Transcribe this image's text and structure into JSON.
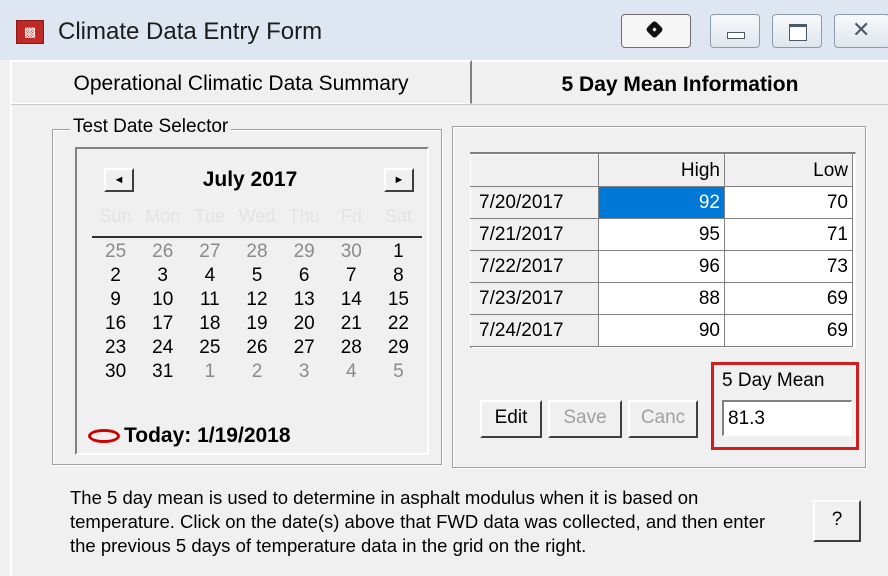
{
  "window": {
    "title": "Climate Data Entry Form"
  },
  "tabs": [
    {
      "label": "Operational Climatic Data Summary",
      "selected": false
    },
    {
      "label": "5 Day Mean Information",
      "selected": true
    }
  ],
  "date_selector": {
    "group_label": "Test Date Selector",
    "prev_arrow": "◄",
    "next_arrow": "►",
    "month_label": "July 2017",
    "weekdays": [
      "Sun",
      "Mon",
      "Tue",
      "Wed",
      "Thu",
      "Fri",
      "Sat"
    ],
    "weeks": [
      [
        "25",
        "26",
        "27",
        "28",
        "29",
        "30",
        "1"
      ],
      [
        "2",
        "3",
        "4",
        "5",
        "6",
        "7",
        "8"
      ],
      [
        "9",
        "10",
        "11",
        "12",
        "13",
        "14",
        "15"
      ],
      [
        "16",
        "17",
        "18",
        "19",
        "20",
        "21",
        "22"
      ],
      [
        "23",
        "24",
        "25",
        "26",
        "27",
        "28",
        "29"
      ],
      [
        "30",
        "31",
        "1",
        "2",
        "3",
        "4",
        "5"
      ]
    ],
    "today_label": "Today: 1/19/2018"
  },
  "grid": {
    "headers": [
      "",
      "High",
      "Low"
    ],
    "rows": [
      {
        "date": "7/20/2017",
        "high": "92",
        "low": "70"
      },
      {
        "date": "7/21/2017",
        "high": "95",
        "low": "71"
      },
      {
        "date": "7/22/2017",
        "high": "96",
        "low": "73"
      },
      {
        "date": "7/23/2017",
        "high": "88",
        "low": "69"
      },
      {
        "date": "7/24/2017",
        "high": "90",
        "low": "69"
      }
    ]
  },
  "buttons": {
    "edit_label": "Edit",
    "save_label": "Save",
    "cancel_label": "Canc",
    "help_label": "?"
  },
  "mean": {
    "label": "5 Day Mean",
    "value": "81.3"
  },
  "help_text": "The 5 day mean is used to determine in asphalt modulus when it is based on temperature.  Click on the date(s) above that FWD data was collected, and then enter the previous 5 days of temperature data in the grid on the right.",
  "colors": {
    "selection": "#0078d7",
    "highlight_border": "#d11f1f",
    "today_circle": "#cc0000"
  }
}
